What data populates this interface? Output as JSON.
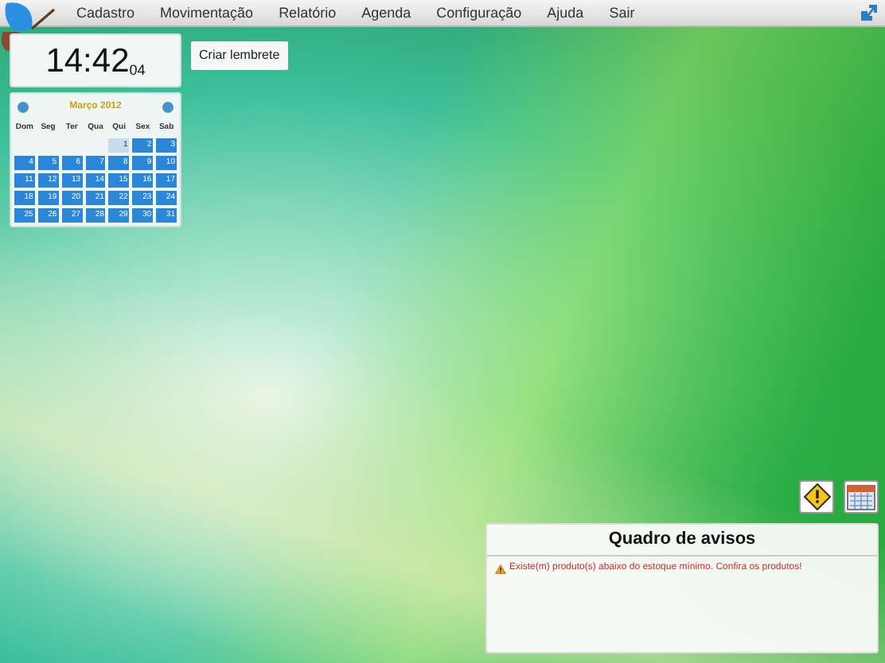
{
  "menu": [
    "Cadastro",
    "Movimentação",
    "Relatório",
    "Agenda",
    "Configuração",
    "Ajuda",
    "Sair"
  ],
  "clock": {
    "hours_minutes": "14:42",
    "seconds": "04"
  },
  "reminder_button": "Criar lembrete",
  "calendar": {
    "month": "Março 2012",
    "weekdays": [
      "Dom",
      "Seg",
      "Ter",
      "Qua",
      "Qui",
      "Sex",
      "Sab"
    ],
    "weeks": [
      [
        {
          "day": "1",
          "today": true
        },
        {
          "day": "2",
          "today": false
        },
        {
          "day": "3",
          "today": false
        }
      ],
      [
        {
          "day": "4",
          "today": false
        },
        {
          "day": "5",
          "today": false
        },
        {
          "day": "6",
          "today": false
        },
        {
          "day": "7",
          "today": false
        },
        {
          "day": "8",
          "today": false
        },
        {
          "day": "9",
          "today": false
        },
        {
          "day": "10",
          "today": false
        }
      ],
      [
        {
          "day": "11",
          "today": false
        },
        {
          "day": "12",
          "today": false
        },
        {
          "day": "13",
          "today": false
        },
        {
          "day": "14",
          "today": false
        },
        {
          "day": "15",
          "today": false
        },
        {
          "day": "16",
          "today": false
        },
        {
          "day": "17",
          "today": false
        }
      ],
      [
        {
          "day": "18",
          "today": false
        },
        {
          "day": "19",
          "today": false
        },
        {
          "day": "20",
          "today": false
        },
        {
          "day": "21",
          "today": false
        },
        {
          "day": "22",
          "today": false
        },
        {
          "day": "23",
          "today": false
        },
        {
          "day": "24",
          "today": false
        }
      ],
      [
        {
          "day": "25",
          "today": false
        },
        {
          "day": "26",
          "today": false
        },
        {
          "day": "27",
          "today": false
        },
        {
          "day": "28",
          "today": false
        },
        {
          "day": "29",
          "today": false
        },
        {
          "day": "30",
          "today": false
        },
        {
          "day": "31",
          "today": false
        }
      ]
    ]
  },
  "notice_board": {
    "title": "Quadro de avisos",
    "messages": [
      "Existe(m) produto(s) abaixo do estoque mínimo. Confira os produtos!"
    ]
  }
}
